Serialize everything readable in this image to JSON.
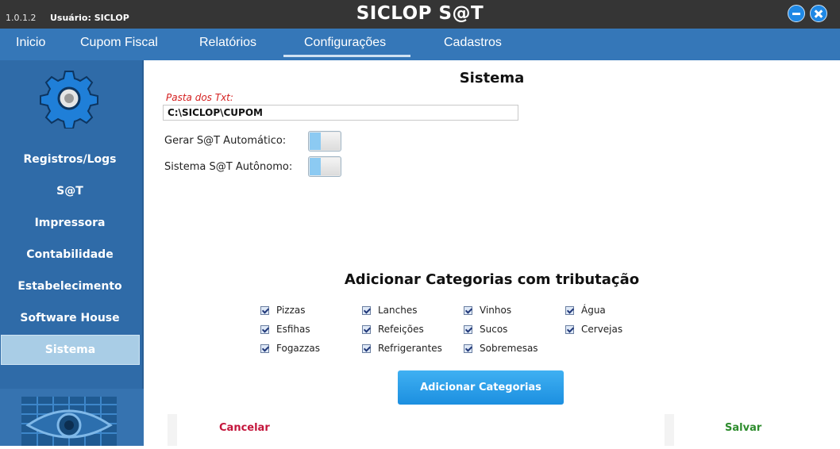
{
  "window": {
    "version": "1.0.1.2",
    "user_label": "Usuário: SICLOP",
    "title": "SICLOP S@T"
  },
  "menu": [
    {
      "label": "Inicio"
    },
    {
      "label": "Cupom Fiscal"
    },
    {
      "label": "Relatórios"
    },
    {
      "label": "Configurações",
      "active": true
    },
    {
      "label": "Cadastros"
    }
  ],
  "sidebar": {
    "items": [
      {
        "label": "Registros/Logs"
      },
      {
        "label": "S@T"
      },
      {
        "label": "Impressora"
      },
      {
        "label": "Contabilidade"
      },
      {
        "label": "Estabelecimento"
      },
      {
        "label": "Software House"
      },
      {
        "label": "Sistema",
        "selected": true
      }
    ]
  },
  "main": {
    "title": "Sistema",
    "txt_folder_label": "Pasta dos Txt:",
    "txt_folder_value": "C:\\SICLOP\\CUPOM",
    "auto_sat_label": "Gerar S@T Automático:",
    "autonomous_label": "Sistema S@T Autônomo:",
    "categories_title": "Adicionar Categorias com tributação",
    "categories": [
      {
        "label": "Pizzas",
        "checked": true
      },
      {
        "label": "Esfihas",
        "checked": true
      },
      {
        "label": "Fogazzas",
        "checked": true
      },
      {
        "label": "Lanches",
        "checked": true
      },
      {
        "label": "Refeições",
        "checked": true
      },
      {
        "label": "Refrigerantes",
        "checked": true
      },
      {
        "label": "Vinhos",
        "checked": true
      },
      {
        "label": "Sucos",
        "checked": true
      },
      {
        "label": "Sobremesas",
        "checked": true
      },
      {
        "label": "Água",
        "checked": true
      },
      {
        "label": "Cervejas",
        "checked": true
      }
    ],
    "add_button": "Adicionar Categorias",
    "cancel": "Cancelar",
    "save": "Salvar"
  },
  "colors": {
    "titlebar": "#353535",
    "menubar": "#3577b8",
    "sidebar": "#2f6ba8",
    "accent_button": "#1c8fe0",
    "cancel": "#c4163c",
    "save": "#2d8c2d",
    "field_label": "#d42020"
  }
}
